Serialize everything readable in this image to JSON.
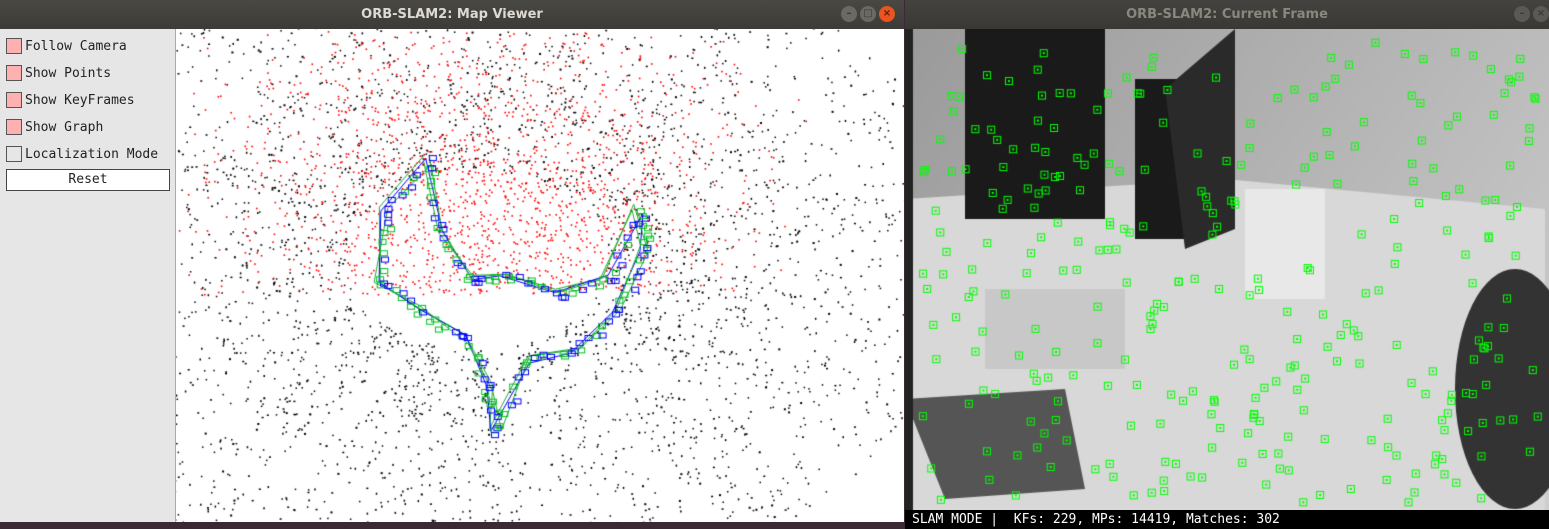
{
  "map_viewer": {
    "title": "ORB-SLAM2: Map Viewer",
    "options": [
      {
        "label": "Follow Camera",
        "checked": true
      },
      {
        "label": "Show Points",
        "checked": true
      },
      {
        "label": "Show KeyFrames",
        "checked": true
      },
      {
        "label": "Show Graph",
        "checked": true
      },
      {
        "label": "Localization Mode",
        "checked": false
      }
    ],
    "reset_label": "Reset",
    "window_buttons": [
      "minimize-icon",
      "maximize-icon",
      "close-icon"
    ]
  },
  "current_frame": {
    "title": "ORB-SLAM2: Current Frame",
    "status": {
      "mode": "SLAM MODE",
      "separator": "|",
      "stats": "KFs: 229, MPs: 14419, Matches: 302"
    },
    "window_buttons": [
      "minimize-icon",
      "close-icon"
    ]
  },
  "colors": {
    "map_points": "#000000",
    "local_points": "#ff0000",
    "keyframes": "#0000ff",
    "graph": "#00cc00",
    "tracked_features": "#00ff00",
    "checkbox_on": "#ffb0b0"
  }
}
